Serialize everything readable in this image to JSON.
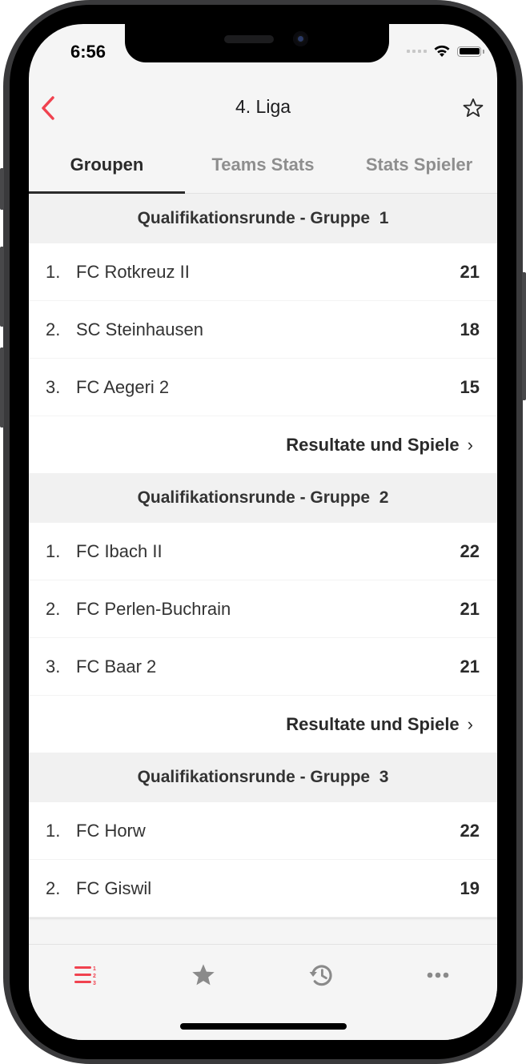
{
  "status_bar": {
    "time": "6:56"
  },
  "colors": {
    "accent": "#f0424f",
    "inactive_icon": "#8a8a8a",
    "text": "#2a2a2a"
  },
  "navbar": {
    "title": "4. Liga",
    "back_icon": "chevron-left-icon",
    "favorite_icon": "star-outline-icon"
  },
  "tabs": [
    {
      "label": "Groupen",
      "active": true
    },
    {
      "label": "Teams Stats",
      "active": false
    },
    {
      "label": "Stats Spieler",
      "active": false
    }
  ],
  "groups": [
    {
      "title": "Qualifikationsrunde - Gruppe  1",
      "teams": [
        {
          "rank": "1.",
          "name": "FC Rotkreuz II",
          "points": "21"
        },
        {
          "rank": "2.",
          "name": "SC Steinhausen",
          "points": "18"
        },
        {
          "rank": "3.",
          "name": "FC Aegeri 2",
          "points": "15"
        }
      ],
      "link_label": "Resultate und Spiele"
    },
    {
      "title": "Qualifikationsrunde - Gruppe  2",
      "teams": [
        {
          "rank": "1.",
          "name": "FC Ibach II",
          "points": "22"
        },
        {
          "rank": "2.",
          "name": "FC Perlen-Buchrain",
          "points": "21"
        },
        {
          "rank": "3.",
          "name": "FC Baar 2",
          "points": "21"
        }
      ],
      "link_label": "Resultate und Spiele"
    },
    {
      "title": "Qualifikationsrunde - Gruppe  3",
      "teams": [
        {
          "rank": "1.",
          "name": "FC Horw",
          "points": "22"
        },
        {
          "rank": "2.",
          "name": "FC Giswil",
          "points": "19"
        }
      ]
    }
  ],
  "tabbar": [
    {
      "icon": "ranked-list-icon",
      "active": true
    },
    {
      "icon": "star-icon",
      "active": false
    },
    {
      "icon": "history-icon",
      "active": false
    },
    {
      "icon": "more-icon",
      "active": false
    }
  ]
}
